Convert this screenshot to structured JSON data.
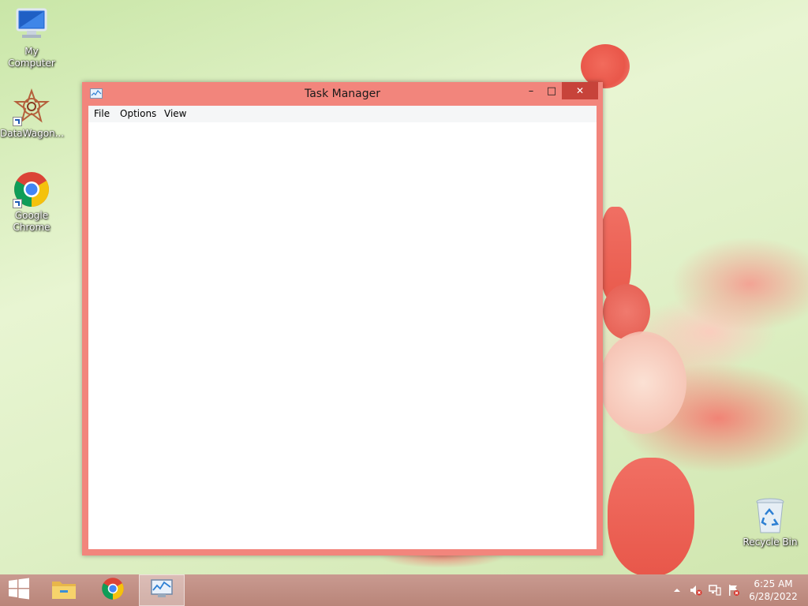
{
  "desktop": {
    "icons": [
      {
        "label": "My Computer",
        "icon": "computer-icon"
      },
      {
        "label": "DataWagon...",
        "icon": "datawagon-icon"
      },
      {
        "label": "Google Chrome",
        "icon": "chrome-icon"
      },
      {
        "label": "Recycle Bin",
        "icon": "recycle-bin-icon"
      }
    ]
  },
  "window": {
    "title": "Task Manager",
    "menu": [
      "File",
      "Options",
      "View"
    ],
    "controls": {
      "minimize": "–",
      "maximize": "□",
      "close": "✕"
    }
  },
  "taskbar": {
    "pinned": [
      "start-icon",
      "file-explorer-icon",
      "chrome-icon",
      "task-manager-icon"
    ],
    "tray": [
      "chevron-up-icon",
      "volume-muted-icon",
      "network-icon",
      "action-center-icon"
    ],
    "clock": {
      "time": "6:25 AM",
      "date": "6/28/2022"
    }
  },
  "colors": {
    "window_frame": "#f2857c",
    "close_button": "#c7433a",
    "taskbar": "#b98579"
  }
}
